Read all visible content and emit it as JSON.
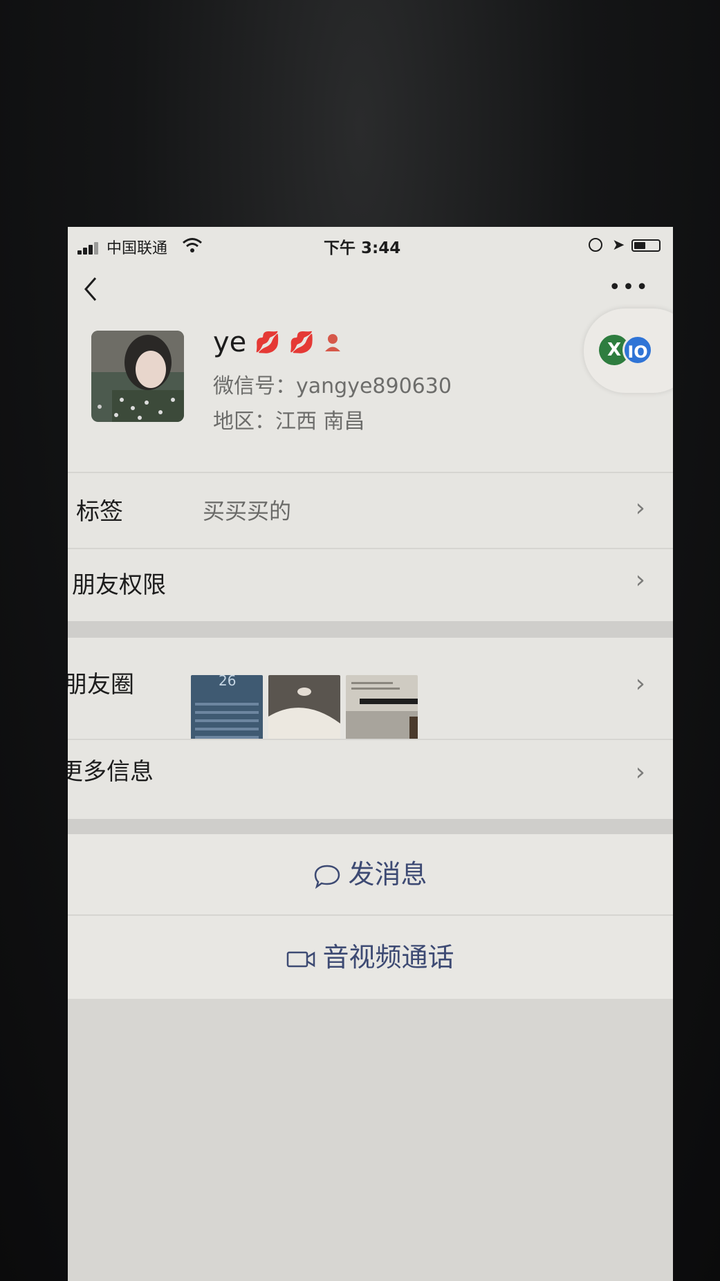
{
  "status_bar": {
    "carrier": "中国联通",
    "time": "下午 3:44"
  },
  "nav": {
    "back_icon": "chevron-left-icon",
    "more_label": "•••"
  },
  "profile": {
    "name": "ye",
    "emoji": "💋",
    "wechat_id": "微信号：yangye890630",
    "region": "地区：江西 南昌"
  },
  "floating_widget": {
    "left_badge": "X",
    "right_badge": "IO"
  },
  "rows": {
    "tags": {
      "label": "标签",
      "value": "买买买的"
    },
    "friend_permission": {
      "label": "朋友权限"
    },
    "moments": {
      "label": "朋友圈",
      "thumb1_text": "26"
    },
    "more_info": {
      "label": "更多信息"
    }
  },
  "actions": {
    "send_message": "发消息",
    "video_call": "音视频通话"
  },
  "colors": {
    "screen_bg": "#e7e6e2",
    "action_text": "#3d4a73",
    "lip_red": "#c72c2c"
  }
}
